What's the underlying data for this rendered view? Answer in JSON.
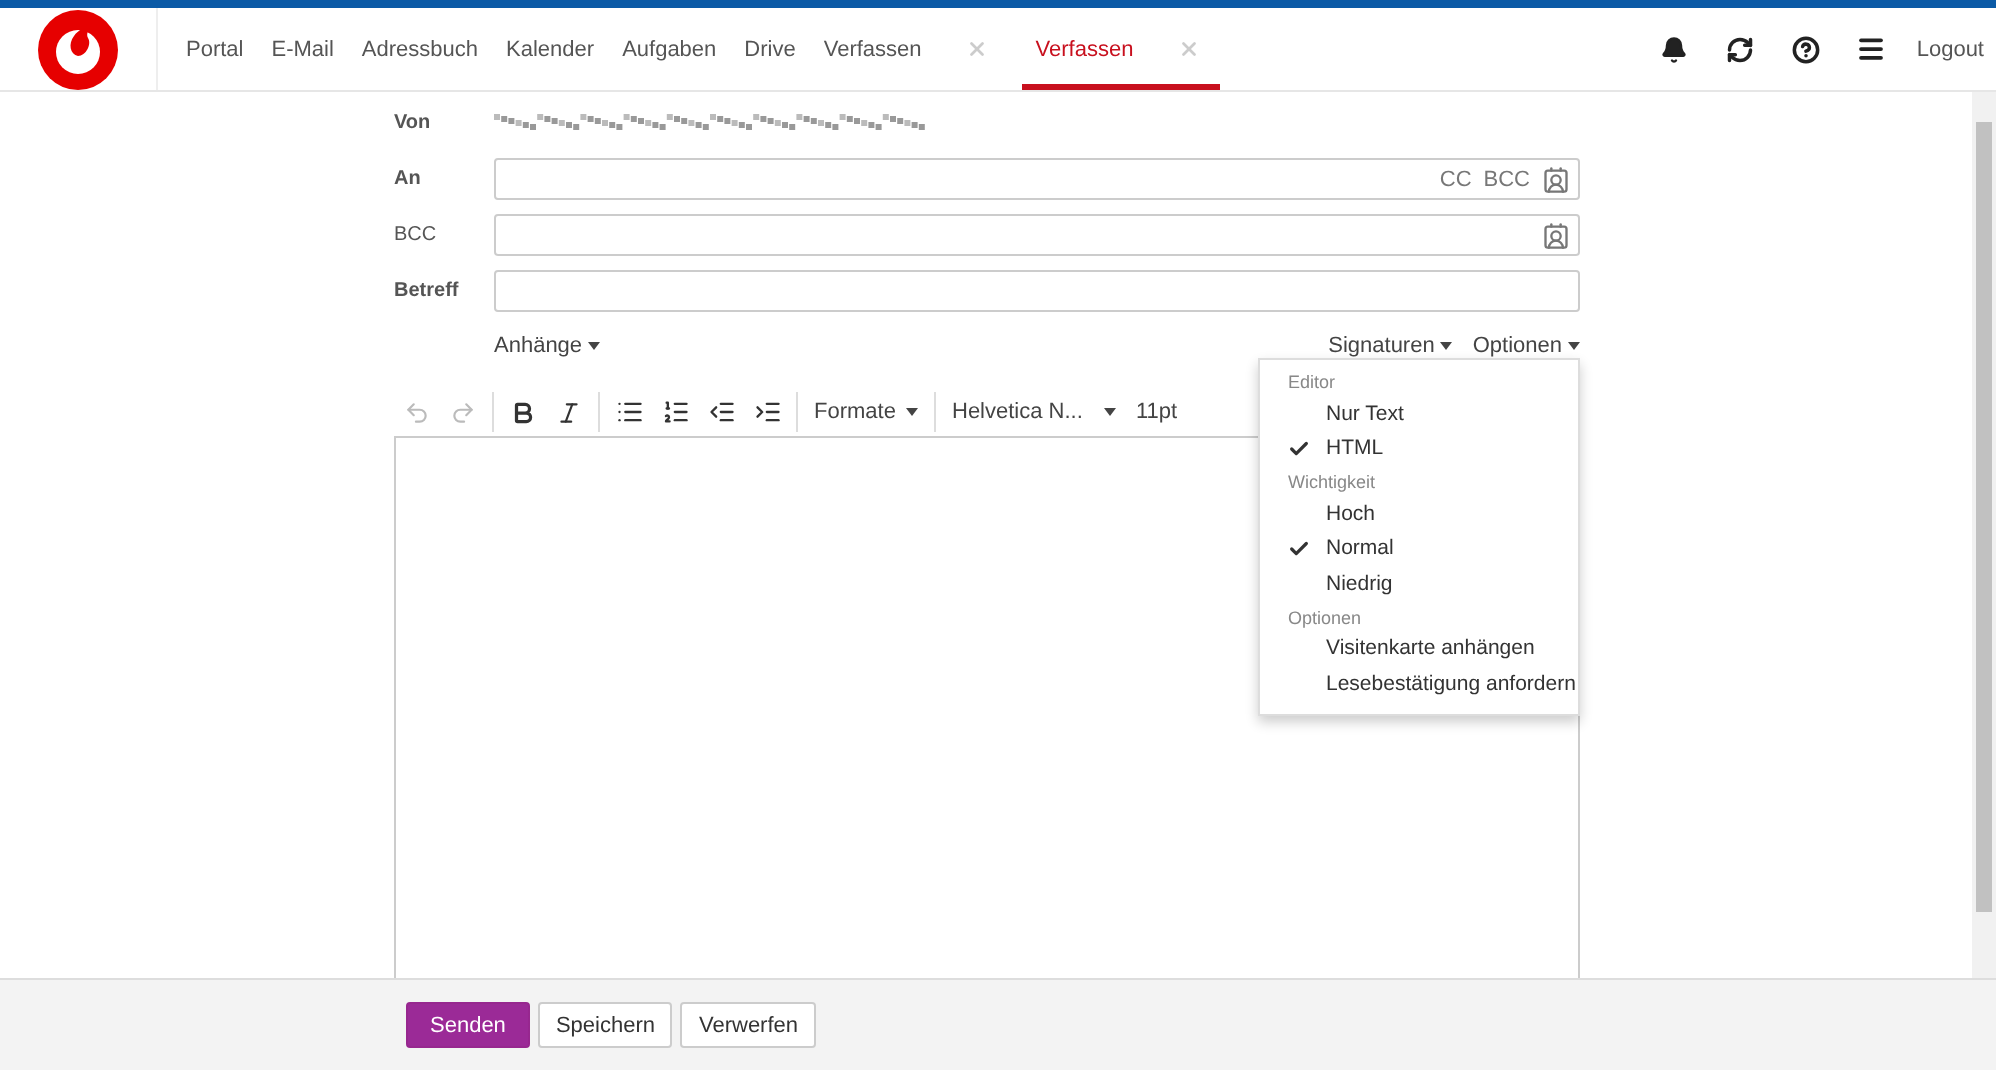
{
  "nav": {
    "items": [
      {
        "label": "Portal",
        "selected": false,
        "closable": false
      },
      {
        "label": "E-Mail",
        "selected": false,
        "closable": false
      },
      {
        "label": "Adressbuch",
        "selected": false,
        "closable": false
      },
      {
        "label": "Kalender",
        "selected": false,
        "closable": false
      },
      {
        "label": "Aufgaben",
        "selected": false,
        "closable": false
      },
      {
        "label": "Drive",
        "selected": false,
        "closable": false
      },
      {
        "label": "Verfassen",
        "selected": false,
        "closable": true
      },
      {
        "label": "Verfassen",
        "selected": true,
        "closable": true
      }
    ],
    "logout": "Logout"
  },
  "compose": {
    "from_label": "Von",
    "to": {
      "label": "An",
      "cc": "CC",
      "bcc": "BCC"
    },
    "bcc": {
      "label": "BCC"
    },
    "subject": {
      "label": "Betreff"
    },
    "attachments": "Anhänge",
    "signatures": "Signaturen",
    "options": "Optionen"
  },
  "toolbar": {
    "formats": "Formate",
    "font": "Helvetica N...",
    "size": "11pt"
  },
  "options_menu": [
    {
      "header": "Editor",
      "items": [
        {
          "label": "Nur Text",
          "checked": false
        },
        {
          "label": "HTML",
          "checked": true
        }
      ]
    },
    {
      "header": "Wichtigkeit",
      "items": [
        {
          "label": "Hoch",
          "checked": false
        },
        {
          "label": "Normal",
          "checked": true
        },
        {
          "label": "Niedrig",
          "checked": false
        }
      ]
    },
    {
      "header": "Optionen",
      "items": [
        {
          "label": "Visitenkarte anhängen",
          "checked": false
        },
        {
          "label": "Lesebestätigung anfordern",
          "checked": false
        }
      ]
    }
  ],
  "buttons": [
    {
      "label": "Senden",
      "kind": "primary"
    },
    {
      "label": "Speichern",
      "kind": "default"
    },
    {
      "label": "Verwerfen",
      "kind": "default"
    }
  ]
}
